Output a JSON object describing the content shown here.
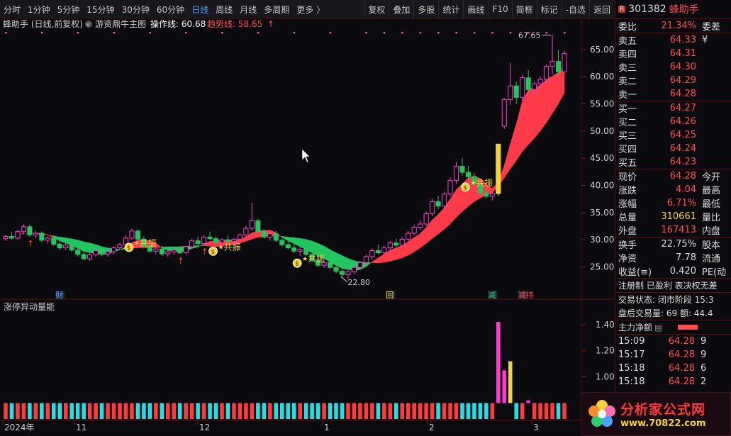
{
  "toolbar": {
    "periods": [
      "分时",
      "1分钟",
      "5分钟",
      "15分钟",
      "30分钟",
      "60分钟",
      "日线",
      "周线",
      "月线",
      "多周期",
      "更多 〉"
    ],
    "active": "日线",
    "tools": [
      "复权",
      "叠加",
      "多股",
      "统计",
      "画线",
      "F10",
      "简框",
      "标记",
      "-自选",
      "返回"
    ]
  },
  "main": {
    "title": "蜂助手 (日线,前复权)",
    "indicator_name": "游资鼎牛主图",
    "op_line_label": "操作线: 60.68",
    "trend_line_label": "趋势线: 58.65",
    "arrow": "↑",
    "high_label": "67.65",
    "low_label": "22.80",
    "resonance_label": "共振",
    "markers": [
      "财",
      "回",
      "减",
      "减持"
    ],
    "money_icon": "$"
  },
  "sub": {
    "title": "涨停异动量能",
    "y_ticks": [
      "1.40",
      "1.20",
      "1.00",
      "0.80"
    ]
  },
  "x_axis": {
    "labels": [
      "2024年",
      "11",
      "12",
      "1",
      "2",
      "3"
    ]
  },
  "price_axis": {
    "ticks": [
      "65.00",
      "60.00",
      "55.00",
      "50.00",
      "45.00",
      "40.00",
      "35.00",
      "30.00",
      "25.00"
    ]
  },
  "quote": {
    "code": "301382",
    "name": "蜂助手",
    "badge": "R",
    "webi_label": "委比",
    "webi_value": "21.34%",
    "webi_extra": "委差",
    "sells": [
      {
        "label": "卖五",
        "value": "64.33",
        "extra": "¥"
      },
      {
        "label": "卖四",
        "value": "64.31"
      },
      {
        "label": "卖三",
        "value": "64.30"
      },
      {
        "label": "卖二",
        "value": "64.29"
      },
      {
        "label": "卖一",
        "value": "64.28"
      }
    ],
    "buys": [
      {
        "label": "买一",
        "value": "64.27"
      },
      {
        "label": "买二",
        "value": "64.26"
      },
      {
        "label": "买三",
        "value": "64.25"
      },
      {
        "label": "买四",
        "value": "64.24"
      },
      {
        "label": "买五",
        "value": "64.23"
      }
    ],
    "stats1": [
      {
        "label": "现价",
        "value": "64.28",
        "extra": "今开",
        "color": "red"
      },
      {
        "label": "涨跌",
        "value": "4.04",
        "extra": "最高",
        "color": "red"
      },
      {
        "label": "涨幅",
        "value": "6.71%",
        "extra": "最低",
        "color": "red"
      },
      {
        "label": "总量",
        "value": "310661",
        "extra": "量比",
        "color": "yel"
      },
      {
        "label": "外盘",
        "value": "167413",
        "extra": "内盘",
        "color": "red"
      }
    ],
    "stats2": [
      {
        "label": "换手",
        "value": "22.75%",
        "extra": "股本",
        "color": "wh"
      },
      {
        "label": "净资",
        "value": "7.78",
        "extra": "流通",
        "color": "wh"
      },
      {
        "label": "收益(≡)",
        "value": "0.420",
        "extra": "PE(动",
        "color": "wh"
      }
    ],
    "flags": "注册制  已盈利  表决权无差",
    "trade_state": "交易状态: 闭市阶段  15:3",
    "after_hours": "盘后交易量: 69  额: 44.4",
    "net_flow": "主力净额",
    "ticks": [
      {
        "time": "15:09",
        "price": "64.28",
        "vol": "9"
      },
      {
        "time": "15:17",
        "price": "64.28",
        "vol": "9"
      },
      {
        "time": "15:18",
        "price": "64.28",
        "vol": "6"
      },
      {
        "time": "15:18",
        "price": "64.28",
        "vol": "2"
      }
    ]
  },
  "logo": {
    "line1": "分析家公式网",
    "line2": "www.70822.com"
  },
  "chart_data": {
    "type": "candlestick",
    "ylim": [
      20.5,
      68.5
    ],
    "x_labels": [
      "2024年",
      "11",
      "12",
      "1",
      "2",
      "3"
    ],
    "candles": [
      [
        30.2,
        30.9,
        29.8,
        30.6
      ],
      [
        30.6,
        31.4,
        30.1,
        30.3
      ],
      [
        30.3,
        31.8,
        30.0,
        31.5
      ],
      [
        31.5,
        32.9,
        31.0,
        32.4
      ],
      [
        32.4,
        32.8,
        30.6,
        30.9
      ],
      [
        30.9,
        31.7,
        30.3,
        31.2
      ],
      [
        31.2,
        31.5,
        29.6,
        29.9
      ],
      [
        29.9,
        30.6,
        29.3,
        30.3
      ],
      [
        30.3,
        30.8,
        28.9,
        29.2
      ],
      [
        29.2,
        29.7,
        28.1,
        28.5
      ],
      [
        28.5,
        29.4,
        28.1,
        29.0
      ],
      [
        29.0,
        29.6,
        27.8,
        28.1
      ],
      [
        28.1,
        28.6,
        26.9,
        27.3
      ],
      [
        27.3,
        27.9,
        26.2,
        26.5
      ],
      [
        26.5,
        27.6,
        26.1,
        27.2
      ],
      [
        27.2,
        28.3,
        26.9,
        28.0
      ],
      [
        28.0,
        28.5,
        27.0,
        27.4
      ],
      [
        27.4,
        28.1,
        26.9,
        27.8
      ],
      [
        27.8,
        28.8,
        27.4,
        28.5
      ],
      [
        28.5,
        29.5,
        28.2,
        29.1
      ],
      [
        29.1,
        30.8,
        28.8,
        30.3
      ],
      [
        30.3,
        32.1,
        29.9,
        31.6
      ],
      [
        31.6,
        31.9,
        29.8,
        30.1
      ],
      [
        30.1,
        30.6,
        28.4,
        28.8
      ],
      [
        28.8,
        29.3,
        27.6,
        27.9
      ],
      [
        27.9,
        28.7,
        27.3,
        28.3
      ],
      [
        28.3,
        28.9,
        27.0,
        27.4
      ],
      [
        27.4,
        28.2,
        26.9,
        27.8
      ],
      [
        27.8,
        28.6,
        27.2,
        28.1
      ],
      [
        28.1,
        28.7,
        27.4,
        27.6
      ],
      [
        27.6,
        28.9,
        27.3,
        28.7
      ],
      [
        28.7,
        30.2,
        28.3,
        29.8
      ],
      [
        29.8,
        30.6,
        29.0,
        29.3
      ],
      [
        29.3,
        30.9,
        29.1,
        30.5
      ],
      [
        30.5,
        31.5,
        29.9,
        30.2
      ],
      [
        30.2,
        30.7,
        29.2,
        29.5
      ],
      [
        29.5,
        30.3,
        29.0,
        30.0
      ],
      [
        30.0,
        30.8,
        29.4,
        29.7
      ],
      [
        29.7,
        30.4,
        29.2,
        30.1
      ],
      [
        30.1,
        31.2,
        29.8,
        30.9
      ],
      [
        30.9,
        32.6,
        30.5,
        32.1
      ],
      [
        32.1,
        36.8,
        31.6,
        33.5
      ],
      [
        33.5,
        33.9,
        31.2,
        31.5
      ],
      [
        31.5,
        32.0,
        30.2,
        30.5
      ],
      [
        30.5,
        31.4,
        29.8,
        31.1
      ],
      [
        31.1,
        31.6,
        29.6,
        29.9
      ],
      [
        29.9,
        30.5,
        28.7,
        29.1
      ],
      [
        29.1,
        29.8,
        28.2,
        28.5
      ],
      [
        28.5,
        29.2,
        27.6,
        27.9
      ],
      [
        27.9,
        28.6,
        27.0,
        28.2
      ],
      [
        28.2,
        28.8,
        27.0,
        27.3
      ],
      [
        27.3,
        27.9,
        25.9,
        26.2
      ],
      [
        26.2,
        26.8,
        25.0,
        25.3
      ],
      [
        25.3,
        26.2,
        24.8,
        25.8
      ],
      [
        25.8,
        26.5,
        24.6,
        24.9
      ],
      [
        24.9,
        25.5,
        23.8,
        24.2
      ],
      [
        24.2,
        24.9,
        23.2,
        23.6
      ],
      [
        23.6,
        24.4,
        22.8,
        24.1
      ],
      [
        24.1,
        25.2,
        23.6,
        24.9
      ],
      [
        24.9,
        26.1,
        24.5,
        25.8
      ],
      [
        25.8,
        27.3,
        25.4,
        26.9
      ],
      [
        26.9,
        28.4,
        26.5,
        28.0
      ],
      [
        28.0,
        29.1,
        27.3,
        27.6
      ],
      [
        27.6,
        28.9,
        27.2,
        28.5
      ],
      [
        28.5,
        29.8,
        28.1,
        29.4
      ],
      [
        29.4,
        30.2,
        28.6,
        29.0
      ],
      [
        29.0,
        30.5,
        28.8,
        30.1
      ],
      [
        30.1,
        31.6,
        29.8,
        31.2
      ],
      [
        31.2,
        32.8,
        30.9,
        32.3
      ],
      [
        32.3,
        33.6,
        31.8,
        32.9
      ],
      [
        32.9,
        35.2,
        32.5,
        34.8
      ],
      [
        34.8,
        37.6,
        34.3,
        37.0
      ],
      [
        37.0,
        38.1,
        35.6,
        36.2
      ],
      [
        36.2,
        38.9,
        35.9,
        38.4
      ],
      [
        38.4,
        41.5,
        37.9,
        40.9
      ],
      [
        40.9,
        44.3,
        40.2,
        43.5
      ],
      [
        43.5,
        45.1,
        41.8,
        42.4
      ],
      [
        42.4,
        43.6,
        41.0,
        41.6
      ],
      [
        41.6,
        42.3,
        39.8,
        40.3
      ],
      [
        40.3,
        41.0,
        38.2,
        38.6
      ],
      [
        38.6,
        39.4,
        37.6,
        38.0
      ],
      [
        38.0,
        38.8,
        37.2,
        38.5
      ],
      [
        38.5,
        47.6,
        38.1,
        47.6
      ],
      [
        50.9,
        56.1,
        50.4,
        55.8
      ],
      [
        55.8,
        62.6,
        54.8,
        58.3
      ],
      [
        58.3,
        59.1,
        55.0,
        56.2
      ],
      [
        56.2,
        60.4,
        55.6,
        59.8
      ],
      [
        59.8,
        61.2,
        57.0,
        57.6
      ],
      [
        57.6,
        59.2,
        56.3,
        58.7
      ],
      [
        58.7,
        60.1,
        57.9,
        59.5
      ],
      [
        59.5,
        62.3,
        58.8,
        61.9
      ],
      [
        61.9,
        67.65,
        60.5,
        62.8
      ],
      [
        62.8,
        64.9,
        60.2,
        60.9
      ],
      [
        60.9,
        64.8,
        60.7,
        64.28
      ]
    ],
    "volume_ratio": [
      0.79,
      0.79,
      0.79,
      0.79,
      0.79,
      0.79,
      0.79,
      0.79,
      0.79,
      0.79,
      0.79,
      0.79,
      0.79,
      0.79,
      0.79,
      0.79,
      0.79,
      0.79,
      0.79,
      0.79,
      0.79,
      0.79,
      0.79,
      0.79,
      0.79,
      0.79,
      0.79,
      0.79,
      0.79,
      0.79,
      0.79,
      0.79,
      0.79,
      0.79,
      0.79,
      0.79,
      0.79,
      0.79,
      0.79,
      0.79,
      0.79,
      0.79,
      0.79,
      0.79,
      0.79,
      0.79,
      0.79,
      0.79,
      0.79,
      0.79,
      0.79,
      0.79,
      0.79,
      0.79,
      0.79,
      0.79,
      0.79,
      0.79,
      0.79,
      0.79,
      0.79,
      0.79,
      0.79,
      0.79,
      0.79,
      0.79,
      0.79,
      0.79,
      0.79,
      0.79,
      0.79,
      0.79,
      0.79,
      0.79,
      0.79,
      0.79,
      0.79,
      0.79,
      0.79,
      0.79,
      0.79,
      0.79,
      1.42,
      1.05,
      1.12,
      0.79,
      0.79,
      0.82,
      0.79,
      0.79,
      0.79,
      0.79,
      0.79,
      0.79
    ]
  }
}
